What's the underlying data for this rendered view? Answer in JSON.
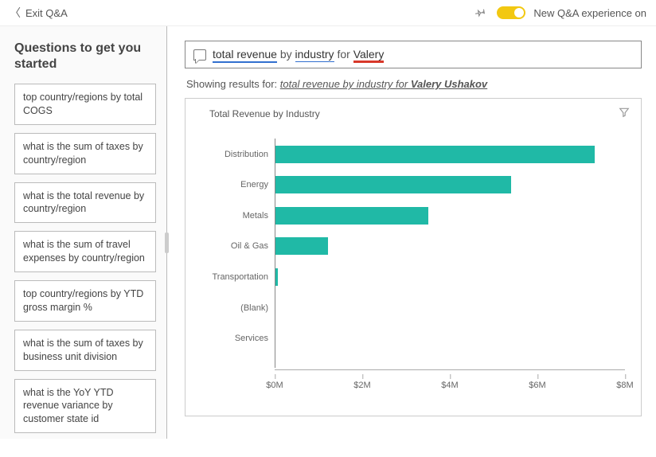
{
  "topbar": {
    "exit_label": "Exit Q&A",
    "toggle_label": "New Q&A experience on"
  },
  "sidebar": {
    "title": "Questions to get you started",
    "questions": [
      "top country/regions by total COGS",
      "what is the sum of taxes by country/region",
      "what is the total revenue by country/region",
      "what is the sum of travel expenses by country/region",
      "top country/regions by YTD gross margin %",
      "what is the sum of taxes by business unit division",
      "what is the YoY YTD revenue variance by customer state id"
    ]
  },
  "query": {
    "part1": "total revenue",
    "part2_plain": " by ",
    "part3": "industry",
    "part4_plain": " for ",
    "part5": "Valery"
  },
  "results": {
    "prefix": "Showing results for: ",
    "italic": "total revenue by industry for ",
    "bold": "Valery Ushakov"
  },
  "chart_data": {
    "type": "bar",
    "title": "Total Revenue by Industry",
    "categories": [
      "Distribution",
      "Energy",
      "Metals",
      "Oil & Gas",
      "Transportation",
      "(Blank)",
      "Services"
    ],
    "values": [
      7.3,
      5.4,
      3.5,
      1.2,
      0.05,
      0.0,
      0.0
    ],
    "xlabel": "",
    "ylabel": "",
    "xlim": [
      0,
      8
    ],
    "xticks": [
      0,
      2,
      4,
      6,
      8
    ],
    "xtick_labels": [
      "$0M",
      "$2M",
      "$4M",
      "$6M",
      "$8M"
    ],
    "value_unit": "$M"
  }
}
